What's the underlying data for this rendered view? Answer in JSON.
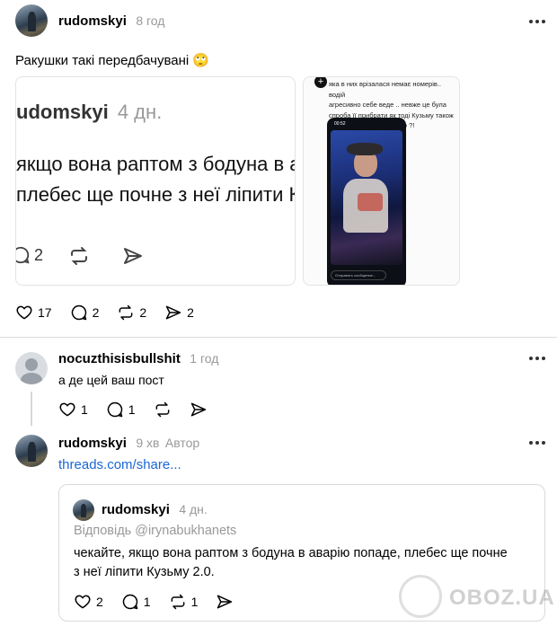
{
  "post": {
    "username": "rudomskyi",
    "time": "8 год",
    "text": "Ракушки такі передбачувані 🙄",
    "screenshot1": {
      "username": "udomskyi",
      "time": "4 дн.",
      "line1": "якщо вона раптом з бодуна в а",
      "line2": "плебес ще почне з неї ліпити Ку",
      "reply_count": "2"
    },
    "screenshot2": {
      "line1": "яка в них врізалася немає номерів.. водій",
      "line2": "агресивно себе веде .. невже це була",
      "line3": "спроба її прибрати як тоді Кузьму також",
      "line4": "після відвертого інтерв'ю ?!",
      "time_small": "00:52",
      "input_placeholder": "Отправить сообщение..."
    },
    "likes": "17",
    "replies": "2",
    "reposts": "2",
    "shares": "2"
  },
  "reply1": {
    "username": "nocuzthisisbullshit",
    "time": "1 год",
    "text": "а де цей ваш пост",
    "likes": "1",
    "replies": "1"
  },
  "reply2": {
    "username": "rudomskyi",
    "time": "9 хв",
    "author_badge": "Автор",
    "link": "threads.com/share...",
    "quote": {
      "username": "rudomskyi",
      "time": "4 дн.",
      "reply_to": "Відповідь @irynabukhanets",
      "text_line1": "чекайте, якщо вона раптом з бодуна в аварію попаде, плебес ще почне",
      "text_line2": "з неї ліпити Кузьму 2.0.",
      "likes": "2",
      "replies": "1",
      "reposts": "1"
    }
  },
  "watermark": "OBOZ.UA",
  "colors": {
    "link": "#1a66d6",
    "muted": "#999999",
    "divider": "#dcdcdc"
  }
}
